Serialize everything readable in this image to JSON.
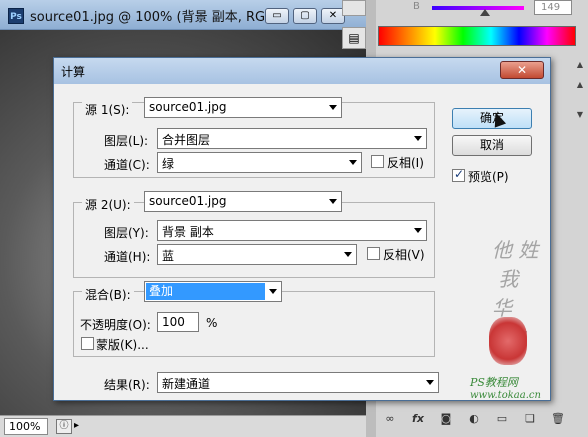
{
  "document_window": {
    "title": "source01.jpg @ 100% (背景 副本, RG...",
    "app_icon": "Ps",
    "controls": {
      "minimize": "▭",
      "restore": "▢",
      "close": "✕"
    },
    "zoom": "100%",
    "status_arrow": "▸"
  },
  "side_panel": {
    "channel_label": "B",
    "channel_value": "149",
    "toolbar_icons": [
      "link-icon",
      "fx-icon",
      "mask-icon",
      "adjustment-icon",
      "folder-icon",
      "new-layer-icon",
      "trash-icon"
    ],
    "toolbar_glyphs": [
      "∞",
      "fx",
      "◙",
      "◐",
      "▭",
      "❏",
      "🗑"
    ]
  },
  "dialog": {
    "title": "计算",
    "close_glyph": "✕",
    "source1": {
      "label": "源 1(S):",
      "file": "source01.jpg",
      "layer_label": "图层(L):",
      "layer_value": "合并图层",
      "channel_label": "通道(C):",
      "channel_value": "绿",
      "invert_label": "反相(I)",
      "invert_checked": false
    },
    "source2": {
      "label": "源 2(U):",
      "file": "source01.jpg",
      "layer_label": "图层(Y):",
      "layer_value": "背景 副本",
      "channel_label": "通道(H):",
      "channel_value": "蓝",
      "invert_label": "反相(V)",
      "invert_checked": false
    },
    "blend": {
      "label": "混合(B):",
      "mode": "叠加",
      "opacity_label": "不透明度(O):",
      "opacity_value": "100",
      "opacity_unit": "%",
      "mask_label": "蒙版(K)...",
      "mask_checked": false
    },
    "result": {
      "label": "结果(R):",
      "value": "新建通道"
    },
    "buttons": {
      "ok": "确定",
      "cancel": "取消"
    },
    "preview": {
      "label": "预览(P)",
      "checked": true,
      "check_glyph": "✓"
    }
  },
  "watermark": {
    "site": "PS教程网",
    "url": "www.tokaa.cn"
  }
}
